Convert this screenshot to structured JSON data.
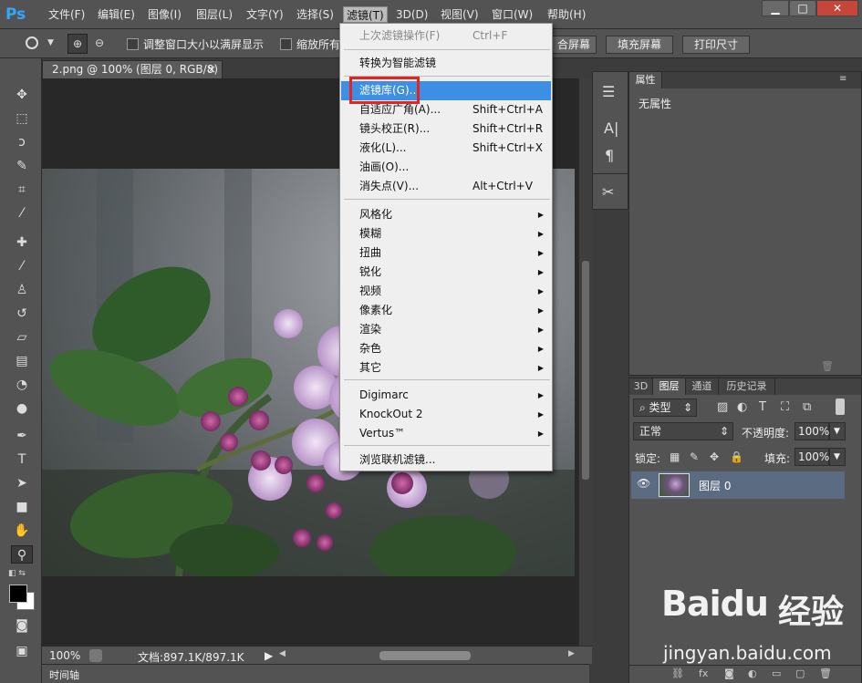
{
  "app": {
    "logo": "Ps"
  },
  "menubar": {
    "items": [
      "文件(F)",
      "编辑(E)",
      "图像(I)",
      "图层(L)",
      "文字(Y)",
      "选择(S)",
      "滤镜(T)",
      "3D(D)",
      "视图(V)",
      "窗口(W)",
      "帮助(H)"
    ],
    "active": "滤镜(T)"
  },
  "window_controls": {
    "minimize": "▁",
    "maximize": "□",
    "close": "✕"
  },
  "options_bar": {
    "resize_windows_label": "调整窗口大小以满屏显示",
    "zoom_all_label": "缩放所有",
    "fit_screen_label": "合屏幕",
    "fill_screen_label": "填充屏幕",
    "print_size_label": "打印尺寸"
  },
  "document": {
    "tab_title": "2.png @ 100% (图层 0, RGB/8)",
    "tab_close": "×",
    "zoom": "100%",
    "doc_info": "文档:897.1K/897.1K"
  },
  "filter_menu": {
    "items": [
      {
        "label": "上次滤镜操作(F)",
        "shortcut": "Ctrl+F",
        "disabled": true
      },
      {
        "label": "转换为智能滤镜"
      },
      {
        "label": "滤镜库(G)...",
        "highlighted": true
      },
      {
        "label": "自适应广角(A)...",
        "shortcut": "Shift+Ctrl+A"
      },
      {
        "label": "镜头校正(R)...",
        "shortcut": "Shift+Ctrl+R"
      },
      {
        "label": "液化(L)...",
        "shortcut": "Shift+Ctrl+X"
      },
      {
        "label": "油画(O)..."
      },
      {
        "label": "消失点(V)...",
        "shortcut": "Alt+Ctrl+V"
      },
      {
        "label": "风格化",
        "submenu": true
      },
      {
        "label": "模糊",
        "submenu": true
      },
      {
        "label": "扭曲",
        "submenu": true
      },
      {
        "label": "锐化",
        "submenu": true
      },
      {
        "label": "视频",
        "submenu": true
      },
      {
        "label": "像素化",
        "submenu": true
      },
      {
        "label": "渲染",
        "submenu": true
      },
      {
        "label": "杂色",
        "submenu": true
      },
      {
        "label": "其它",
        "submenu": true
      },
      {
        "label": "Digimarc",
        "submenu": true
      },
      {
        "label": "KnockOut 2",
        "submenu": true
      },
      {
        "label": "Vertus™",
        "submenu": true
      },
      {
        "label": "浏览联机滤镜..."
      }
    ]
  },
  "properties_panel": {
    "tab": "属性",
    "content": "无属性"
  },
  "layers_panel": {
    "tabs": [
      "3D",
      "图层",
      "通道",
      "历史记录"
    ],
    "active_tab": "图层",
    "filter_kind": "类型",
    "blend_mode": "正常",
    "opacity_label": "不透明度:",
    "opacity_value": "100%",
    "lock_label": "锁定:",
    "fill_label": "填充:",
    "fill_value": "100%",
    "layers": [
      {
        "name": "图层 0",
        "visible": true
      }
    ]
  },
  "timeline": {
    "label": "时间轴"
  },
  "watermark": {
    "brand": "Baidu",
    "cn": "经验",
    "url": "jingyan.baidu.com"
  },
  "colors": {
    "menu_highlight": "#3d8fe3",
    "callout_border": "#e8221e",
    "panel_bg": "#535353",
    "canvas_bg": "#282828"
  }
}
